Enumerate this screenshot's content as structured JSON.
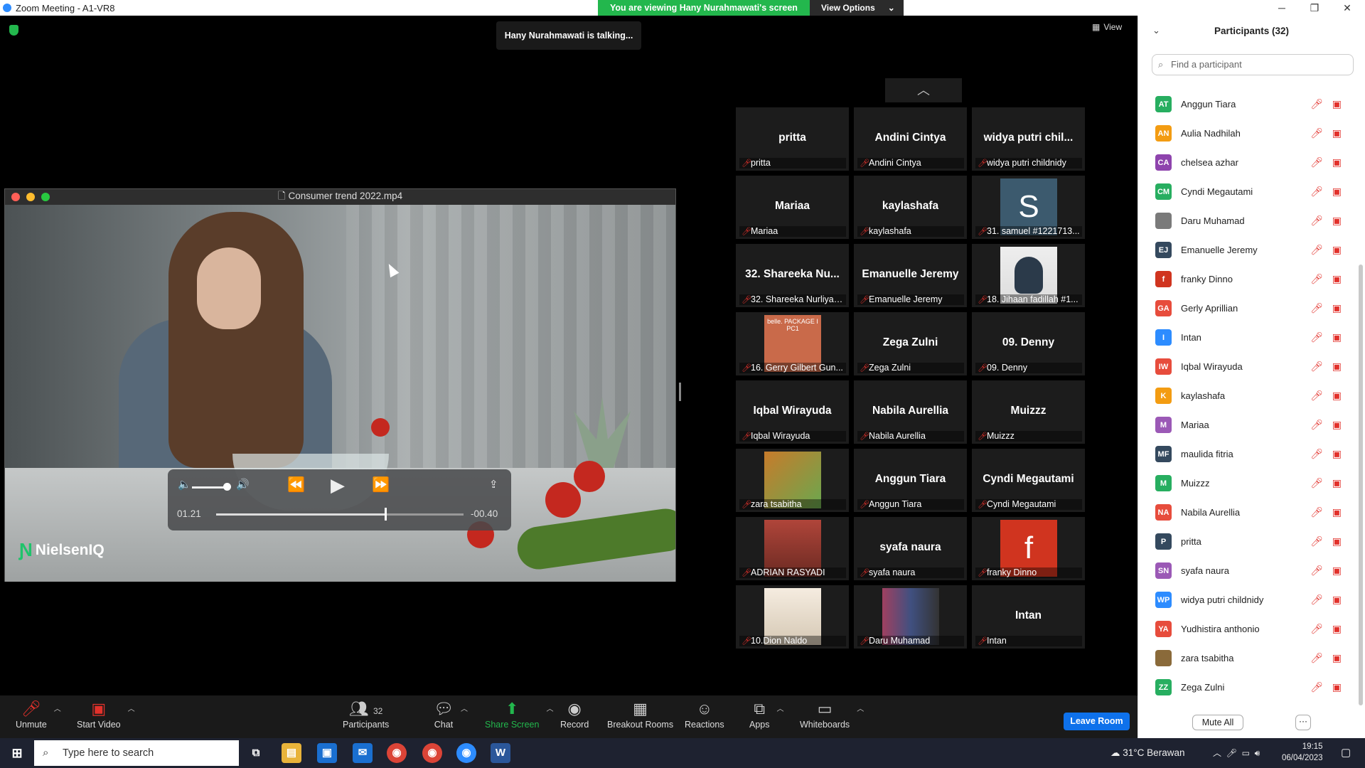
{
  "window": {
    "title": "Zoom Meeting - A1-VR8",
    "min": "─",
    "max": "❐",
    "close": "✕"
  },
  "banner": {
    "viewing": "You are viewing Hany Nurahmawati's screen",
    "options": "View Options",
    "options_caret": "⌄"
  },
  "meeting": {
    "talking": "Hany Nurahmawati is talking...",
    "view_label": "View",
    "view_icon": "▦"
  },
  "player": {
    "title": "Consumer trend 2022.mp4",
    "file_icon": "🗋",
    "brand": "NielsenIQ",
    "current_time": "01.21",
    "remaining_time": "-00.40",
    "progress": 0.68,
    "volume": 0.85,
    "icons": {
      "mute": "🔈",
      "loud": "🔊",
      "rewind": "⏪",
      "play": "▶",
      "forward": "⏩",
      "share": "⇪"
    }
  },
  "gallery": {
    "scroll_up": "︿",
    "tiles": [
      {
        "big": "pritta",
        "name": "pritta"
      },
      {
        "big": "Andini Cintya",
        "name": "Andini Cintya"
      },
      {
        "big": "widya putri chil...",
        "name": "widya putri childnidy"
      },
      {
        "big": "Mariaa",
        "name": "Mariaa"
      },
      {
        "big": "kaylashafa",
        "name": "kaylashafa"
      },
      {
        "big": "S",
        "name": "31. samuel #1221713..."
      },
      {
        "big": "32. Shareeka Nu...",
        "name": "32. Shareeka Nurliyan..."
      },
      {
        "big": "Emanuelle Jeremy",
        "name": "Emanuelle Jeremy"
      },
      {
        "big": "",
        "name": "18. Jihaan fadillah #1..."
      },
      {
        "big": "",
        "name": "16. Gerry Gilbert Gun..."
      },
      {
        "big": "Zega Zulni",
        "name": "Zega Zulni"
      },
      {
        "big": "09. Denny",
        "name": "09. Denny"
      },
      {
        "big": "Iqbal Wirayuda",
        "name": "Iqbal Wirayuda"
      },
      {
        "big": "Nabila Aurellia",
        "name": "Nabila Aurellia"
      },
      {
        "big": "Muizzz",
        "name": "Muizzz"
      },
      {
        "big": "",
        "name": "zara tsabitha"
      },
      {
        "big": "Anggun Tiara",
        "name": "Anggun Tiara"
      },
      {
        "big": "Cyndi Megautami",
        "name": "Cyndi Megautami"
      },
      {
        "big": "",
        "name": "ADRIAN RASYADI"
      },
      {
        "big": "syafa naura",
        "name": "syafa naura"
      },
      {
        "big": "f",
        "name": "franky Dinno"
      },
      {
        "big": "",
        "name": "10.Dion Naldo"
      },
      {
        "big": "",
        "name": "Daru Muhamad"
      },
      {
        "big": "Intan",
        "name": "Intan"
      }
    ],
    "belle_text": "belle.\nPACKAGE I PC1"
  },
  "toolbar": {
    "unmute": "Unmute",
    "start_video": "Start Video",
    "participants": "Participants",
    "participants_count": "32",
    "chat": "Chat",
    "share": "Share Screen",
    "record": "Record",
    "breakout": "Breakout Rooms",
    "reactions": "Reactions",
    "apps": "Apps",
    "whiteboards": "Whiteboards",
    "leave": "Leave Room"
  },
  "panel": {
    "title": "Participants (32)",
    "collapse": "⌄",
    "search_placeholder": "Find a participant",
    "participants": [
      {
        "initials": "AT",
        "name": "Anggun Tiara",
        "color": "#27ae60"
      },
      {
        "initials": "AN",
        "name": "Aulia Nadhilah",
        "color": "#f39c12"
      },
      {
        "initials": "CA",
        "name": "chelsea azhar",
        "color": "#8e44ad"
      },
      {
        "initials": "CM",
        "name": "Cyndi Megautami",
        "color": "#27ae60"
      },
      {
        "initials": "",
        "name": "Daru Muhamad",
        "color": "#7a7a7a"
      },
      {
        "initials": "EJ",
        "name": "Emanuelle Jeremy",
        "color": "#34495e"
      },
      {
        "initials": "f",
        "name": "franky Dinno",
        "color": "#d0341f"
      },
      {
        "initials": "GA",
        "name": "Gerly Aprillian",
        "color": "#e74c3c"
      },
      {
        "initials": "I",
        "name": "Intan",
        "color": "#2d8cff"
      },
      {
        "initials": "IW",
        "name": "Iqbal Wirayuda",
        "color": "#e74c3c"
      },
      {
        "initials": "K",
        "name": "kaylashafa",
        "color": "#f39c12"
      },
      {
        "initials": "M",
        "name": "Mariaa",
        "color": "#9b59b6"
      },
      {
        "initials": "MF",
        "name": "maulida fitria",
        "color": "#34495e"
      },
      {
        "initials": "M",
        "name": "Muizzz",
        "color": "#27ae60"
      },
      {
        "initials": "NA",
        "name": "Nabila Aurellia",
        "color": "#e74c3c"
      },
      {
        "initials": "P",
        "name": "pritta",
        "color": "#34495e"
      },
      {
        "initials": "SN",
        "name": "syafa naura",
        "color": "#9b59b6"
      },
      {
        "initials": "WP",
        "name": "widya putri childnidy",
        "color": "#2d8cff"
      },
      {
        "initials": "YA",
        "name": "Yudhistira anthonio",
        "color": "#e74c3c"
      },
      {
        "initials": "",
        "name": "zara tsabitha",
        "color": "#8a6a3a"
      },
      {
        "initials": "ZZ",
        "name": "Zega Zulni",
        "color": "#27ae60"
      }
    ],
    "mute_all": "Mute All",
    "more": "···"
  },
  "taskbar": {
    "search_placeholder": "Type here to search",
    "weather": "31°C  Berawan",
    "time": "19:15",
    "date": "06/04/2023"
  }
}
